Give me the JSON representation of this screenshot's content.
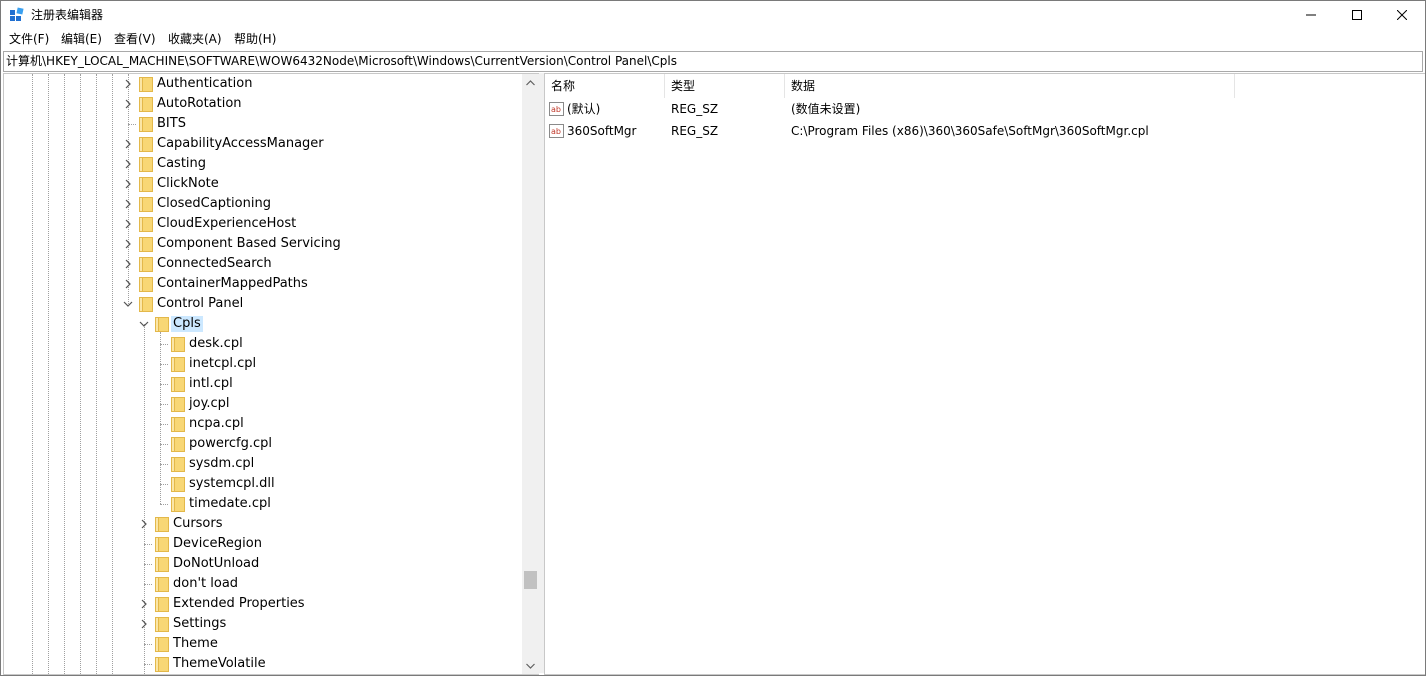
{
  "window": {
    "title": "注册表编辑器",
    "minimize_icon": "minimize-icon",
    "maximize_icon": "maximize-icon",
    "close_icon": "close-icon"
  },
  "menu": [
    {
      "label": "文件(F)"
    },
    {
      "label": "编辑(E)"
    },
    {
      "label": "查看(V)"
    },
    {
      "label": "收藏夹(A)"
    },
    {
      "label": "帮助(H)"
    }
  ],
  "address": {
    "path": "计算机\\HKEY_LOCAL_MACHINE\\SOFTWARE\\WOW6432Node\\Microsoft\\Windows\\CurrentVersion\\Control Panel\\Cpls"
  },
  "tree": {
    "items": [
      {
        "label": "Authentication",
        "level": 0,
        "expander": "collapsed"
      },
      {
        "label": "AutoRotation",
        "level": 0,
        "expander": "collapsed"
      },
      {
        "label": "BITS",
        "level": 0,
        "expander": "none"
      },
      {
        "label": "CapabilityAccessManager",
        "level": 0,
        "expander": "collapsed"
      },
      {
        "label": "Casting",
        "level": 0,
        "expander": "collapsed"
      },
      {
        "label": "ClickNote",
        "level": 0,
        "expander": "collapsed"
      },
      {
        "label": "ClosedCaptioning",
        "level": 0,
        "expander": "collapsed"
      },
      {
        "label": "CloudExperienceHost",
        "level": 0,
        "expander": "collapsed"
      },
      {
        "label": "Component Based Servicing",
        "level": 0,
        "expander": "collapsed"
      },
      {
        "label": "ConnectedSearch",
        "level": 0,
        "expander": "collapsed"
      },
      {
        "label": "ContainerMappedPaths",
        "level": 0,
        "expander": "collapsed"
      },
      {
        "label": "Control Panel",
        "level": 0,
        "expander": "expanded"
      },
      {
        "label": "Cpls",
        "level": 1,
        "expander": "expanded",
        "selected": true
      },
      {
        "label": "desk.cpl",
        "level": 2,
        "expander": "none"
      },
      {
        "label": "inetcpl.cpl",
        "level": 2,
        "expander": "none"
      },
      {
        "label": "intl.cpl",
        "level": 2,
        "expander": "none"
      },
      {
        "label": "joy.cpl",
        "level": 2,
        "expander": "none"
      },
      {
        "label": "ncpa.cpl",
        "level": 2,
        "expander": "none"
      },
      {
        "label": "powercfg.cpl",
        "level": 2,
        "expander": "none"
      },
      {
        "label": "sysdm.cpl",
        "level": 2,
        "expander": "none"
      },
      {
        "label": "systemcpl.dll",
        "level": 2,
        "expander": "none"
      },
      {
        "label": "timedate.cpl",
        "level": 2,
        "expander": "none"
      },
      {
        "label": "Cursors",
        "level": 1,
        "expander": "collapsed"
      },
      {
        "label": "DeviceRegion",
        "level": 1,
        "expander": "none"
      },
      {
        "label": "DoNotUnload",
        "level": 1,
        "expander": "none"
      },
      {
        "label": "don't load",
        "level": 1,
        "expander": "none"
      },
      {
        "label": "Extended Properties",
        "level": 1,
        "expander": "collapsed"
      },
      {
        "label": "Settings",
        "level": 1,
        "expander": "collapsed"
      },
      {
        "label": "Theme",
        "level": 1,
        "expander": "none"
      },
      {
        "label": "ThemeVolatile",
        "level": 1,
        "expander": "none"
      }
    ]
  },
  "list": {
    "columns": [
      {
        "label": "名称"
      },
      {
        "label": "类型"
      },
      {
        "label": "数据"
      }
    ],
    "rows": [
      {
        "name": "(默认)",
        "type": "REG_SZ",
        "data": "(数值未设置)"
      },
      {
        "name": "360SoftMgr",
        "type": "REG_SZ",
        "data": "C:\\Program Files (x86)\\360\\360Safe\\SoftMgr\\360SoftMgr.cpl"
      }
    ]
  },
  "colors": {
    "selection": "#cce8ff",
    "folder": "#f8d775",
    "folder_edge": "#e3b84a"
  }
}
